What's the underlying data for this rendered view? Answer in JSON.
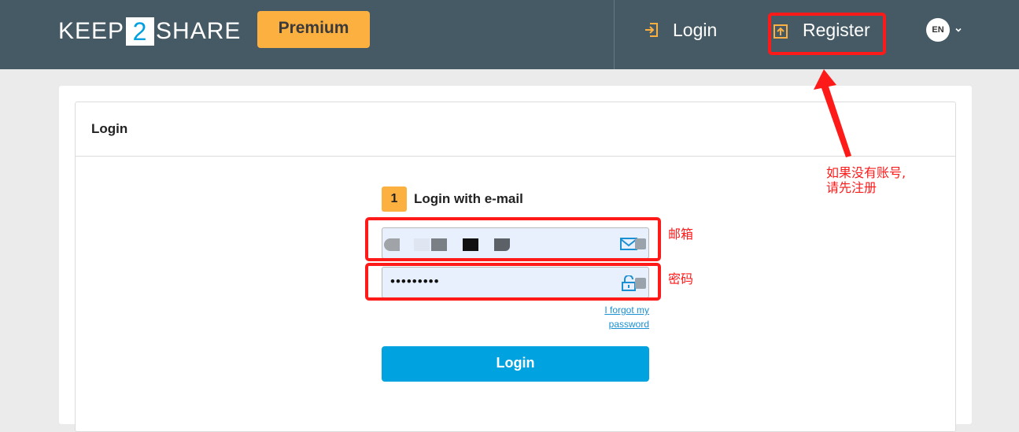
{
  "header": {
    "logo_left": "KEEP",
    "logo_box": "2",
    "logo_right": "SHARE",
    "premium_label": "Premium",
    "login_label": "Login",
    "register_label": "Register",
    "language": "EN"
  },
  "card": {
    "title": "Login",
    "step_number": "1",
    "step_label": "Login with e-mail",
    "password_value": "•••••••••",
    "forgot_line1": "I forgot my",
    "forgot_line2": "password",
    "login_button": "Login"
  },
  "annotations": {
    "email_note": "邮箱",
    "password_note": "密码",
    "register_note_line1": "如果没有账号,",
    "register_note_line2": "请先注册"
  },
  "colors": {
    "topbar": "#455a64",
    "accent_orange": "#fbb040",
    "accent_blue": "#00a3e0",
    "annotation_red": "#ff1a1a"
  }
}
